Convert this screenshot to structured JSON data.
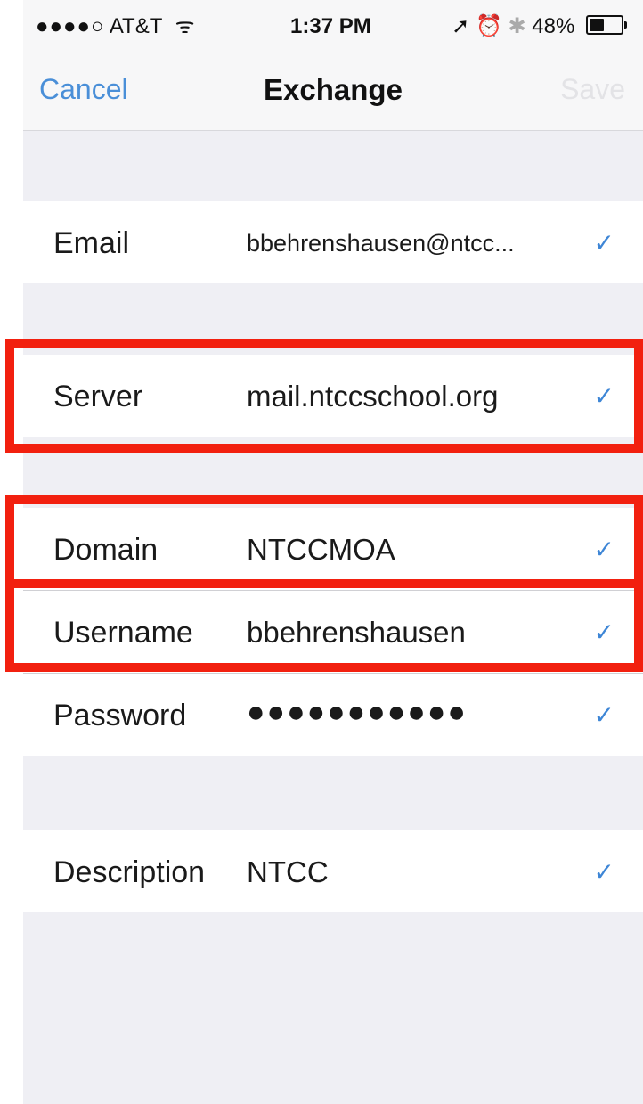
{
  "status_bar": {
    "signal": "●●●●○",
    "carrier": "AT&T",
    "wifi_icon": "wifi-icon",
    "time": "1:37 PM",
    "location_icon": "➚",
    "alarm_icon": "⏰",
    "bluetooth_icon": "✱",
    "battery_percent": "48%",
    "battery_level": 0.48
  },
  "nav": {
    "cancel_label": "Cancel",
    "title": "Exchange",
    "save_label": "Save"
  },
  "fields": {
    "email": {
      "label": "Email",
      "value": "bbehrenshausen@ntcc..."
    },
    "server": {
      "label": "Server",
      "value": "mail.ntccschool.org"
    },
    "domain": {
      "label": "Domain",
      "value": "NTCCMOA"
    },
    "username": {
      "label": "Username",
      "value": "bbehrenshausen"
    },
    "password": {
      "label": "Password",
      "value": "●●●●●●●●●●●"
    },
    "description": {
      "label": "Description",
      "value": "NTCC"
    }
  },
  "check_glyph": "✓",
  "colors": {
    "accent": "#4a8fd8",
    "check": "#3e86d6",
    "highlight": "#f2200f",
    "background": "#efeff4"
  }
}
